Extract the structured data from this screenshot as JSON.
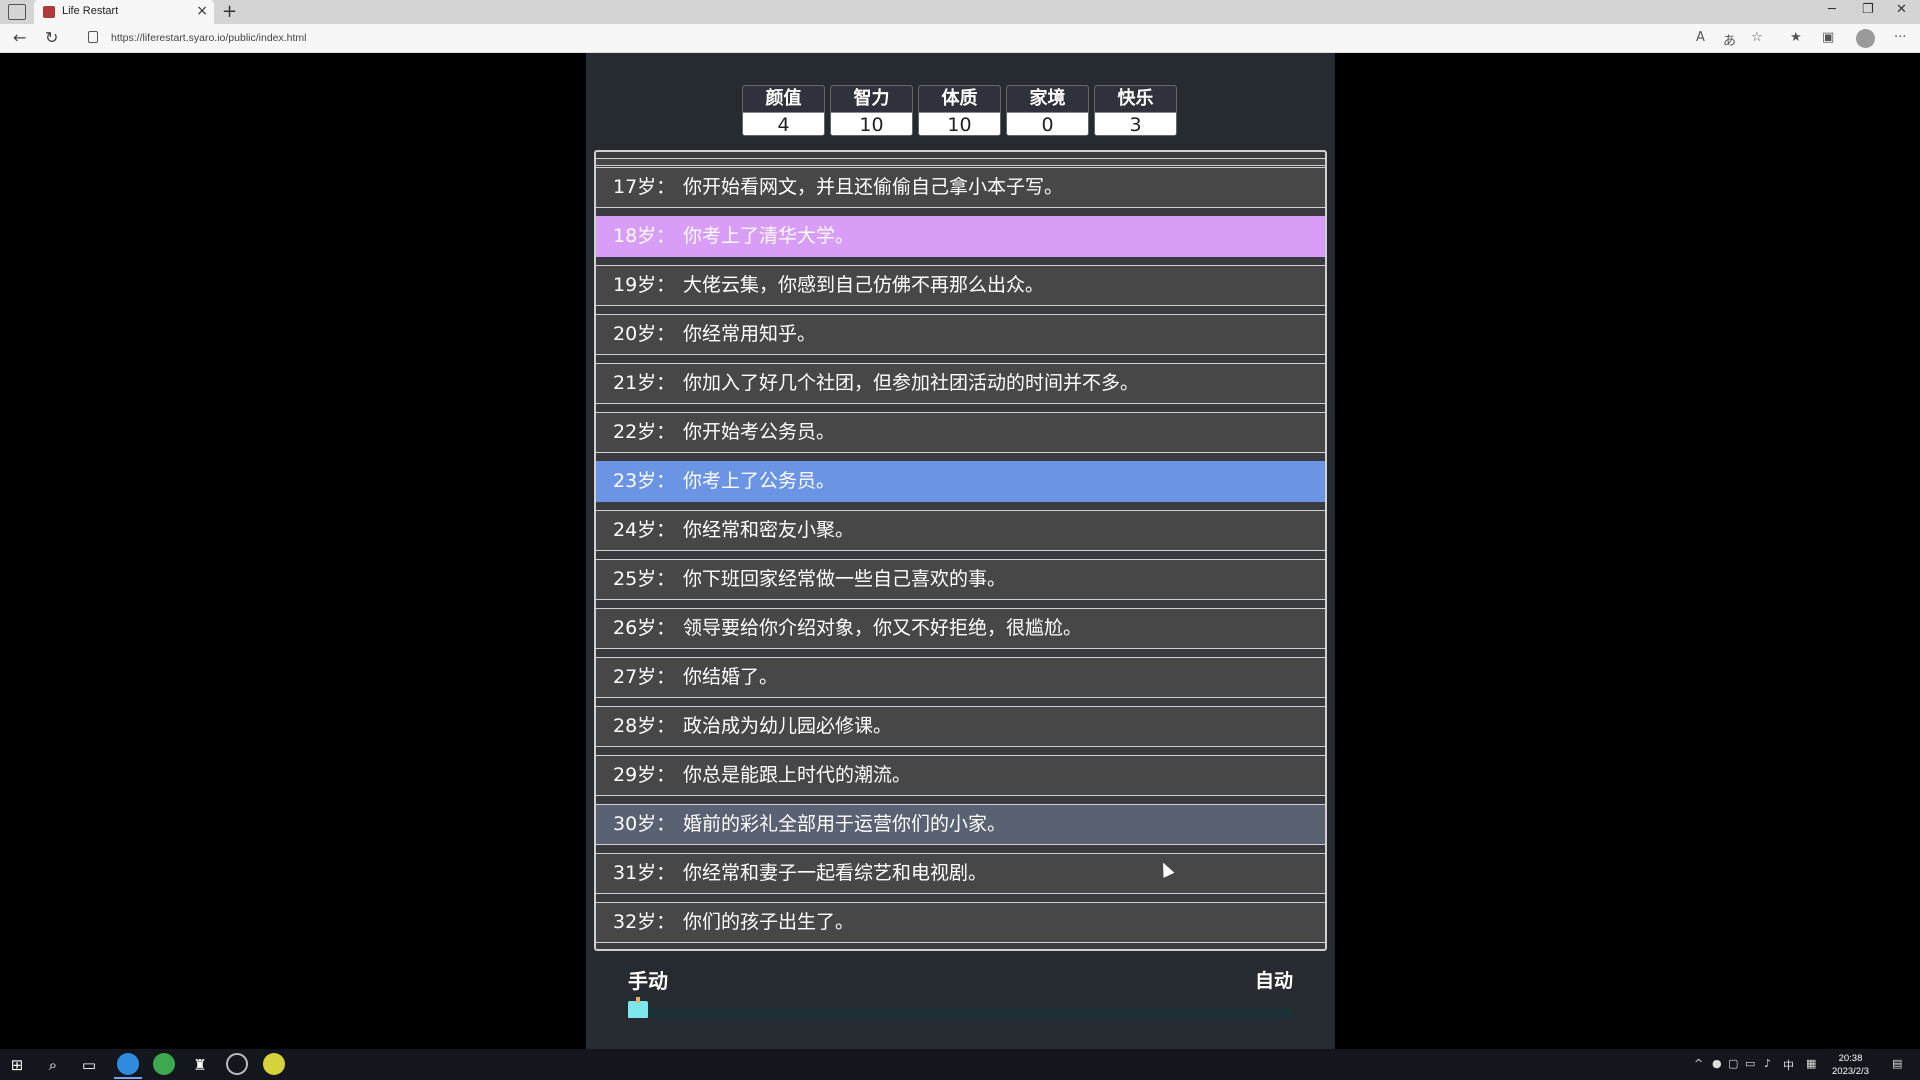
{
  "browser": {
    "tab_title": "Life Restart",
    "url": "https://liferestart.syaro.io/public/index.html"
  },
  "stats": [
    {
      "label": "颜值",
      "value": "4"
    },
    {
      "label": "智力",
      "value": "10"
    },
    {
      "label": "体质",
      "value": "10"
    },
    {
      "label": "家境",
      "value": "0"
    },
    {
      "label": "快乐",
      "value": "3"
    }
  ],
  "log": [
    {
      "age": "17岁：",
      "text": "你开始看网文，并且还偷偷自己拿小本子写。"
    },
    {
      "age": "18岁：",
      "text": "你考上了清华大学。"
    },
    {
      "age": "19岁：",
      "text": "大佬云集，你感到自己仿佛不再那么出众。"
    },
    {
      "age": "20岁：",
      "text": "你经常用知乎。"
    },
    {
      "age": "21岁：",
      "text": "你加入了好几个社团，但参加社团活动的时间并不多。"
    },
    {
      "age": "22岁：",
      "text": "你开始考公务员。"
    },
    {
      "age": "23岁：",
      "text": "你考上了公务员。"
    },
    {
      "age": "24岁：",
      "text": "你经常和密友小聚。"
    },
    {
      "age": "25岁：",
      "text": "你下班回家经常做一些自己喜欢的事。"
    },
    {
      "age": "26岁：",
      "text": "领导要给你介绍对象，你又不好拒绝，很尴尬。"
    },
    {
      "age": "27岁：",
      "text": "你结婚了。"
    },
    {
      "age": "28岁：",
      "text": "政治成为幼儿园必修课。"
    },
    {
      "age": "29岁：",
      "text": "你总是能跟上时代的潮流。"
    },
    {
      "age": "30岁：",
      "text": "婚前的彩礼全部用于运营你们的小家。"
    },
    {
      "age": "31岁：",
      "text": "你经常和妻子一起看综艺和电视剧。"
    },
    {
      "age": "32岁：",
      "text": "你们的孩子出生了。"
    }
  ],
  "speed": {
    "manual_label": "手动",
    "auto_label": "自动",
    "level": 0.0
  },
  "taskbar": {
    "time": "20:38",
    "date": "2023/2/3",
    "ime": "中"
  },
  "colors": {
    "highlight_gold": "#d89ef7",
    "highlight_blue": "#6b94e5",
    "panel": "#262a31"
  }
}
